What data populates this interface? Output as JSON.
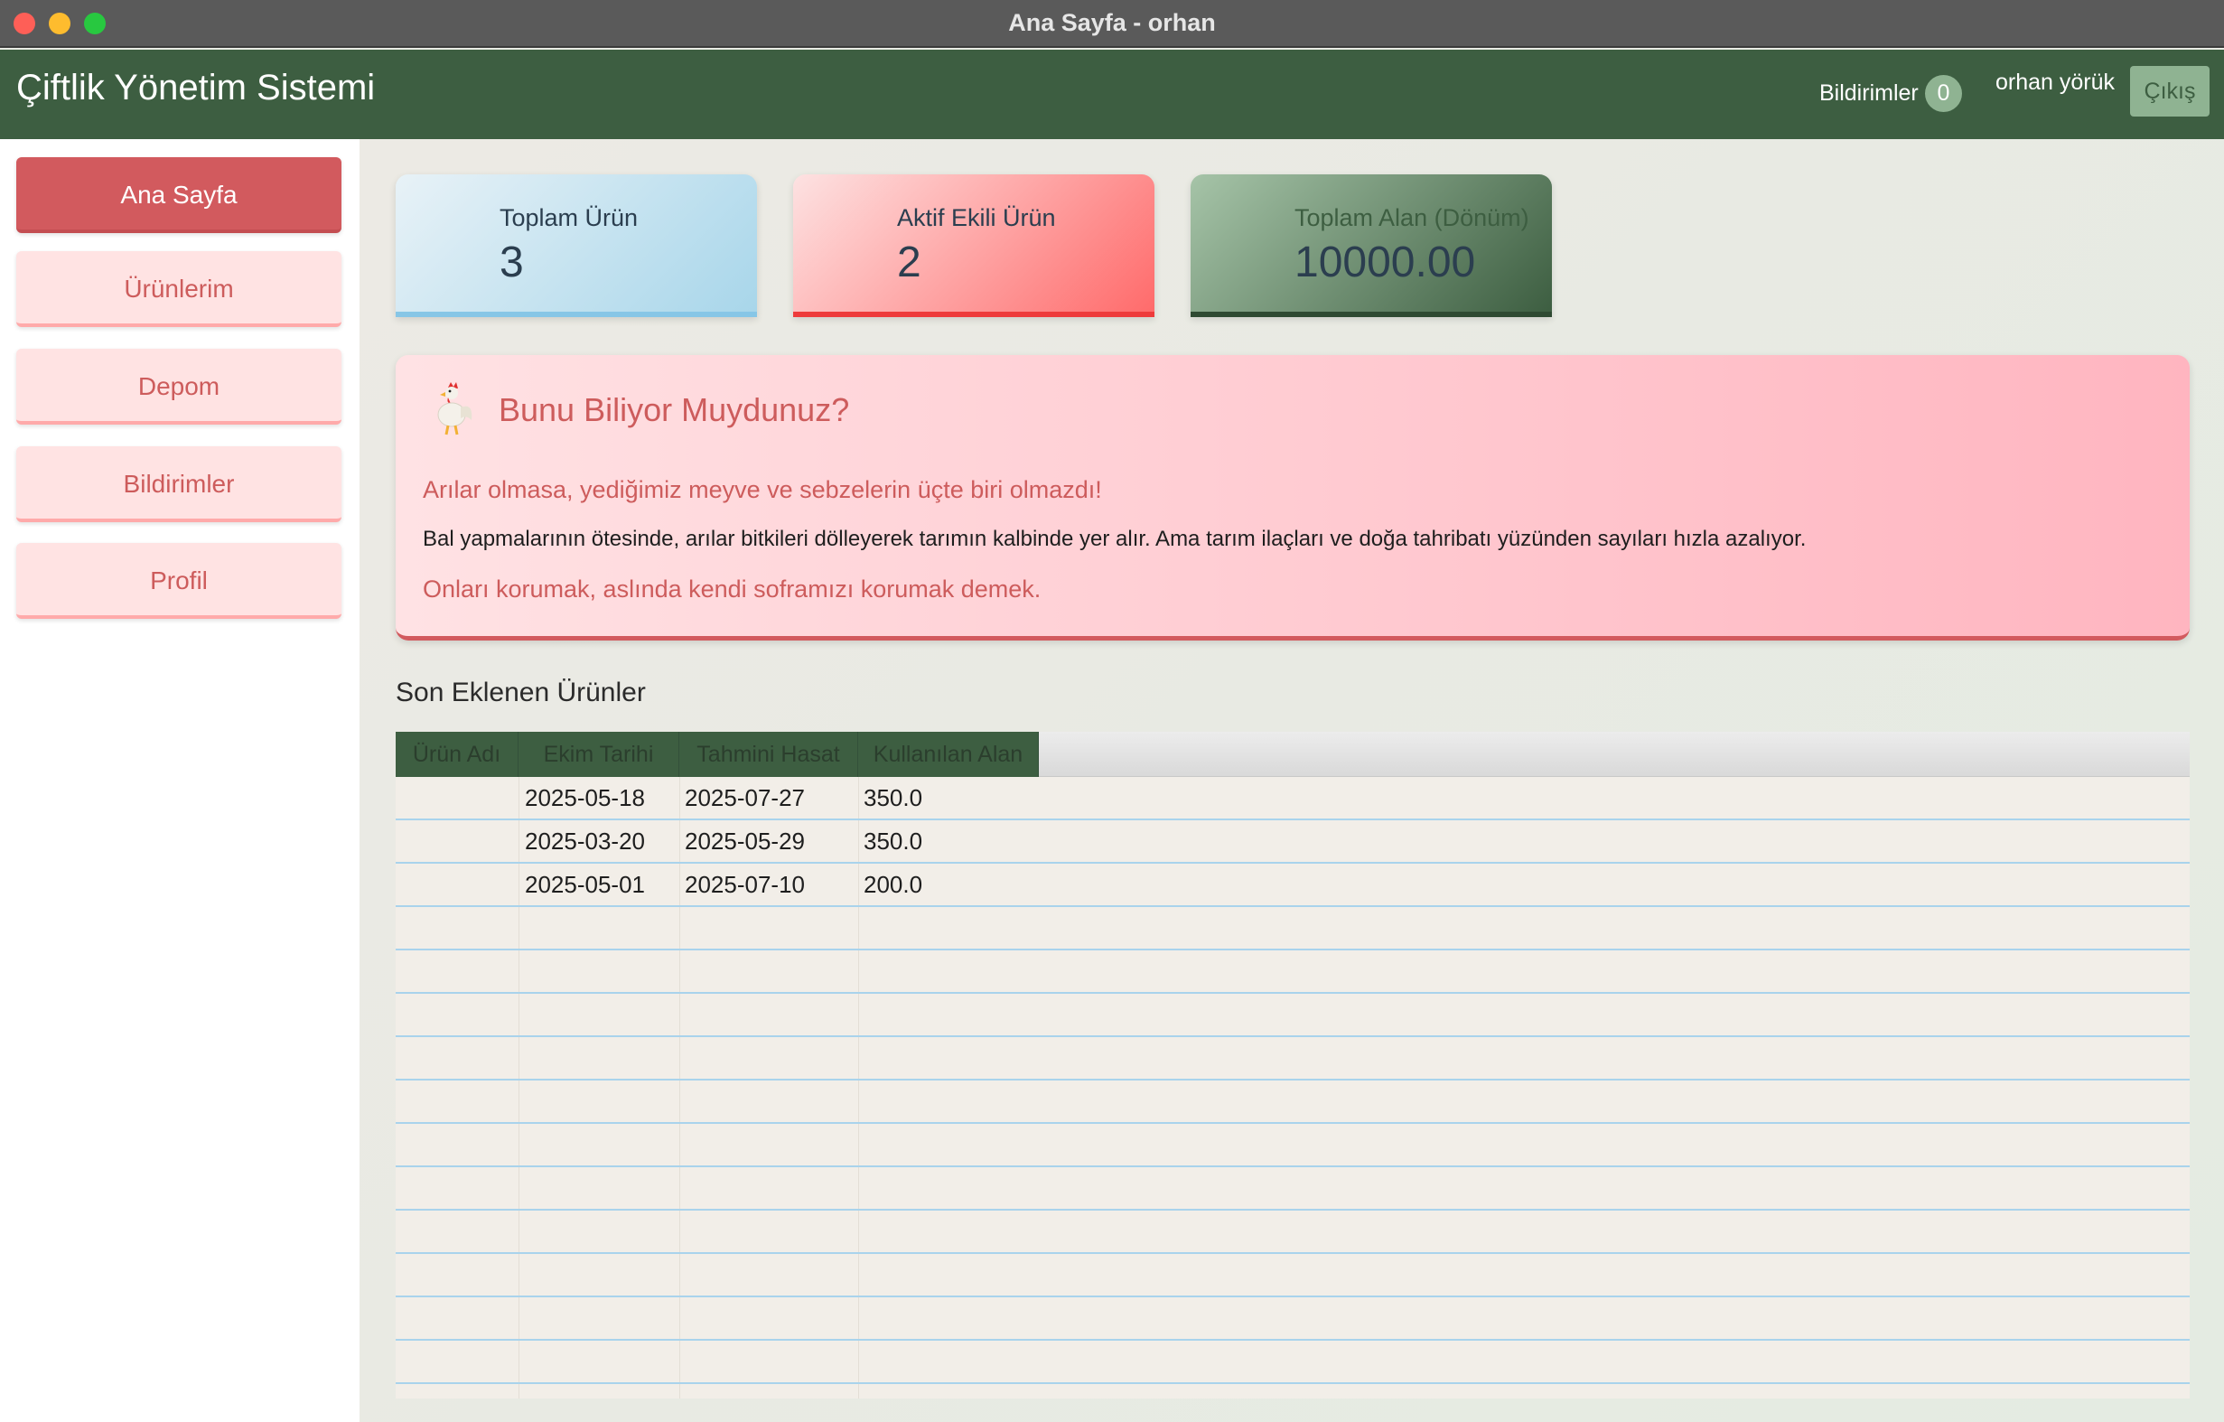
{
  "window": {
    "title": "Ana Sayfa - orhan"
  },
  "header": {
    "app_title": "Çiftlik Yönetim Sistemi",
    "notifications_label": "Bildirimler",
    "notifications_count": "0",
    "user_name": "orhan yörük",
    "logout_label": "Çıkış"
  },
  "sidebar": {
    "items": [
      {
        "label": "Ana Sayfa",
        "active": true
      },
      {
        "label": "Ürünlerim",
        "active": false
      },
      {
        "label": "Depom",
        "active": false
      },
      {
        "label": "Bildirimler",
        "active": false
      },
      {
        "label": "Profil",
        "active": false
      }
    ]
  },
  "stats": {
    "total_products": {
      "label": "Toplam Ürün",
      "value": "3"
    },
    "active_planted": {
      "label": "Aktif Ekili Ürün",
      "value": "2"
    },
    "total_area": {
      "label": "Toplam Alan (Dönüm)",
      "value": "10000.00"
    }
  },
  "fact": {
    "icon": "rooster-icon",
    "title": "Bunu Biliyor Muydunuz?",
    "line1": "Arılar olmasa, yediğimiz meyve ve sebzelerin üçte biri olmazdı!",
    "line2": "Bal yapmalarının ötesinde, arılar bitkileri dölleyerek tarımın kalbinde yer alır. Ama tarım ilaçları ve doğa tahribatı yüzünden sayıları hızla azalıyor.",
    "line3": "Onları korumak, aslında kendi soframızı korumak demek."
  },
  "recent": {
    "title": "Son Eklenen Ürünler",
    "columns": [
      "Ürün Adı",
      "Ekim Tarihi",
      "Tahmini Hasat",
      "Kullanılan Alan"
    ],
    "rows": [
      [
        "",
        "2025-05-18",
        "2025-07-27",
        "350.0"
      ],
      [
        "",
        "2025-03-20",
        "2025-05-29",
        "350.0"
      ],
      [
        "",
        "2025-05-01",
        "2025-07-10",
        "200.0"
      ]
    ]
  },
  "colors": {
    "header_green": "#3d5e41",
    "accent_red": "#d25a5e",
    "nav_pink": "#ffe3e3",
    "grid_line_blue": "#a9d3ec"
  }
}
